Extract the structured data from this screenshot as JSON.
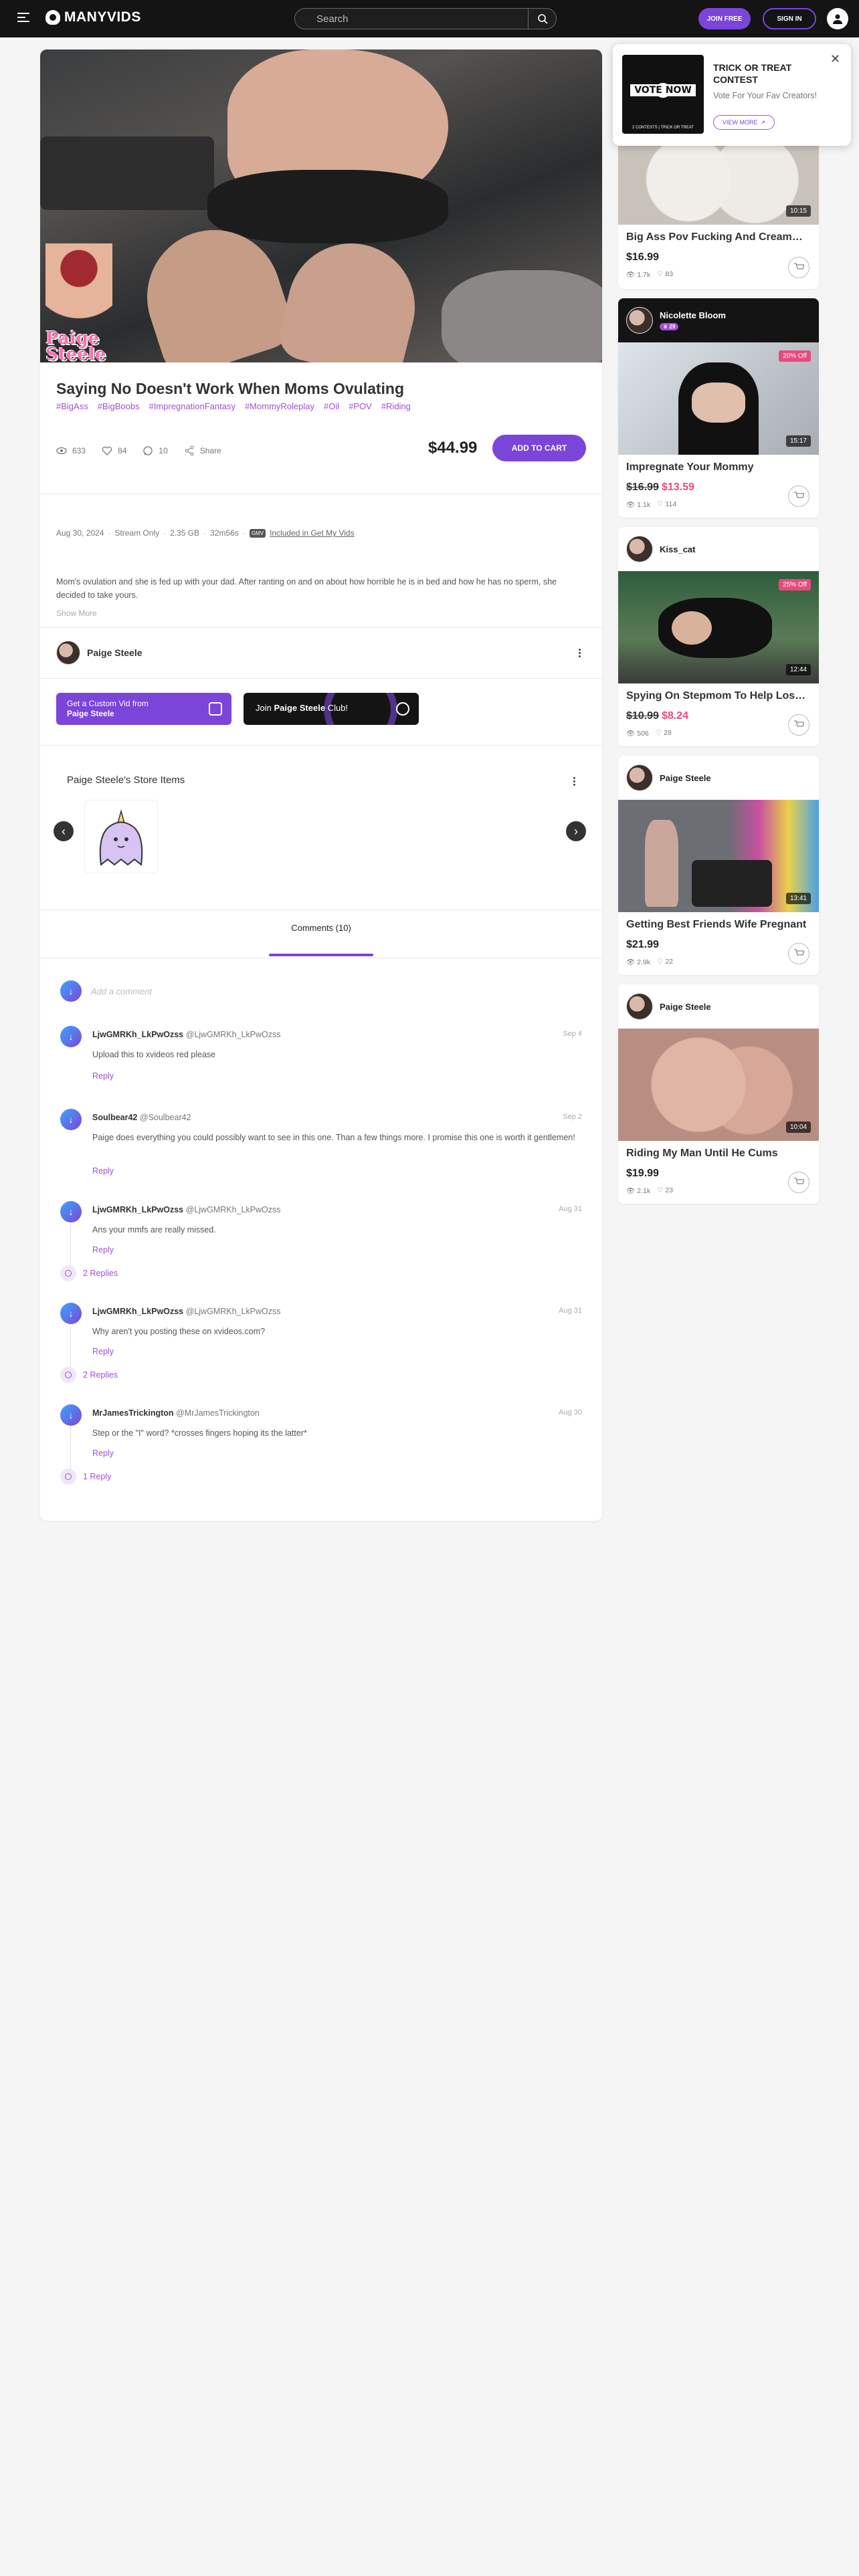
{
  "header": {
    "logo": "MANYVIDS",
    "search_placeholder": "Search",
    "join_label": "JOIN FREE",
    "signin_label": "SIGN IN"
  },
  "video": {
    "hero_signature": "Paige Steele",
    "title": "Saying No Doesn't Work When Moms Ovulating",
    "tags": [
      "#BigAss",
      "#BigBoobs",
      "#ImpregnationFantasy",
      "#MommyRoleplay",
      "#Oil",
      "#POV",
      "#Riding"
    ],
    "views": "633",
    "likes": "84",
    "comments": "10",
    "share_label": "Share",
    "price": "$44.99",
    "cart_label": "ADD TO CART",
    "date": "Aug 30, 2024",
    "stream": "Stream Only",
    "size": "2.35 GB",
    "duration": "32m56s",
    "gmv_badge": "GMV",
    "gmv_link": "Included in Get My Vids",
    "description": "Mom's ovulation and she is fed up with your dad. After ranting on and on about how horrible he is in bed and how he has no sperm, she decided to take yours.",
    "show_more": "Show More"
  },
  "creator": {
    "name": "Paige Steele",
    "custom_line1": "Get a Custom Vid from",
    "custom_line2": "Paige Steele",
    "club_prefix": "Join ",
    "club_name": "Paige Steele",
    "club_suffix": " Club!",
    "store_title": "Paige Steele's Store Items"
  },
  "comments": {
    "tab_label": "Comments (10)",
    "add_placeholder": "Add a comment",
    "reply_label": "Reply",
    "items": [
      {
        "user": "LjwGMRKh_LkPwOzss",
        "handle": "@LjwGMRKh_LkPwOzss",
        "date": "Sep 4",
        "text": "Upload this to xvideos red please",
        "replies": ""
      },
      {
        "user": "Soulbear42",
        "handle": "@Soulbear42",
        "date": "Sep 2",
        "text": "Paige does everything you could possibly want to see in this one. Than a few things more. I promise this one is worth it gentlemen!",
        "replies": ""
      },
      {
        "user": "LjwGMRKh_LkPwOzss",
        "handle": "@LjwGMRKh_LkPwOzss",
        "date": "Aug 31",
        "text": "Ans your mmfs are really missed.",
        "replies": "2 Replies"
      },
      {
        "user": "LjwGMRKh_LkPwOzss",
        "handle": "@LjwGMRKh_LkPwOzss",
        "date": "Aug 31",
        "text": "Why aren't you posting these on xvideos.com?",
        "replies": "2 Replies"
      },
      {
        "user": "MrJamesTrickington",
        "handle": "@MrJamesTrickington",
        "date": "Aug 30",
        "text": "Step or the \"I\" word? *crosses fingers hoping its the latter*",
        "replies": "1 Reply"
      }
    ]
  },
  "popup": {
    "image_vote": "VOTE NOW",
    "image_foot": "2 CONTESTS | TRICK OR TREAT",
    "title": "TRICK OR TREAT CONTEST",
    "subtitle": "Vote For Your Fav Creators!",
    "button": "VIEW MORE"
  },
  "sidebar": {
    "cards": [
      {
        "creator": "",
        "duration": "10:15",
        "title": "Big Ass Pov Fucking And Creampie",
        "price": "$16.99",
        "old_price": "",
        "discount": "",
        "views": "1.7k",
        "likes": "83"
      },
      {
        "creator": "Nicolette Bloom",
        "badge": "♛ 29",
        "duration": "15:17",
        "title": "Impregnate Your Mommy",
        "price": "$13.59",
        "old_price": "$16.99",
        "discount": "20% Off",
        "views": "1.1k",
        "likes": "114"
      },
      {
        "creator": "Kiss_cat",
        "duration": "12:44",
        "title": "Spying On Stepmom To Help Lose Virginity",
        "price": "$8.24",
        "old_price": "$10.99",
        "discount": "25% Off",
        "views": "506",
        "likes": "28"
      },
      {
        "creator": "Paige Steele",
        "duration": "13:41",
        "title": "Getting Best Friends Wife Pregnant",
        "price": "$21.99",
        "old_price": "",
        "discount": "",
        "views": "2.9k",
        "likes": "22"
      },
      {
        "creator": "Paige Steele",
        "duration": "10:04",
        "title": "Riding My Man Until He Cums",
        "price": "$19.99",
        "old_price": "",
        "discount": "",
        "views": "2.1k",
        "likes": "23"
      }
    ]
  },
  "colors": {
    "accent": "#7b45d9",
    "tag": "#a24fd8",
    "sale": "#e84a7f",
    "topbar": "#141414"
  }
}
